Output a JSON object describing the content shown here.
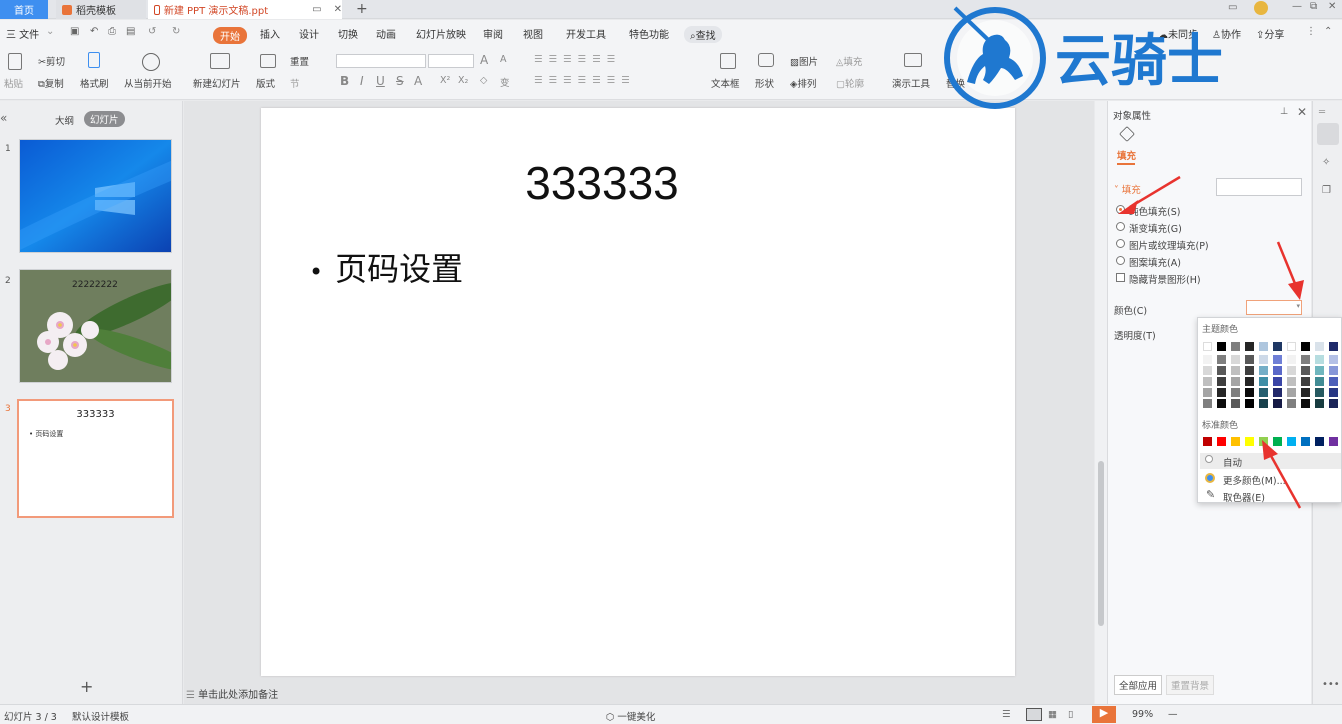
{
  "titlebar": {
    "home_tab": "首页",
    "template_tab": "稻壳模板",
    "doc_tab": "新建 PPT 演示文稿.ppt",
    "new_tab": "+"
  },
  "menubar": {
    "file": "三 文件",
    "start": "开始",
    "items": [
      "插入",
      "设计",
      "切换",
      "动画",
      "幻灯片放映",
      "审阅",
      "视图",
      "开发工具",
      "特色功能"
    ],
    "search": "查找",
    "sync": "未同步",
    "collab": "协作",
    "share": "分享"
  },
  "ribbon": {
    "paste": "粘贴",
    "cut": "剪切",
    "copy": "复制",
    "format_painter": "格式刷",
    "from_current": "从当前开始",
    "new_slide": "新建幻灯片",
    "layout": "版式",
    "reset": "重置",
    "section": "节",
    "textbox": "文本框",
    "shape": "形状",
    "picture": "图片",
    "arrange": "排列",
    "fill": "填充",
    "outline": "轮廓",
    "presentation_tools": "演示工具",
    "replace": "替换"
  },
  "leftpane": {
    "outline_tab": "大纲",
    "slides_tab": "幻灯片",
    "slide_numbers": [
      "1",
      "2",
      "3"
    ],
    "slide2_title": "22222222",
    "slide3_title": "333333",
    "slide3_bullet": "• 页码设置",
    "add": "+"
  },
  "slide": {
    "title": "333333",
    "bullet": "页码设置"
  },
  "notes": "单击此处添加备注",
  "rightpanel": {
    "header": "对象属性",
    "fill_tab": "填充",
    "fill_section": "填充",
    "options": [
      "纯色填充(S)",
      "渐变填充(G)",
      "图片或纹理填充(P)",
      "图案填充(A)"
    ],
    "hide_bg": "隐藏背景图形(H)",
    "color_label": "颜色(C)",
    "transparency_label": "透明度(T)",
    "apply_all": "全部应用",
    "reset_bg": "重置背景"
  },
  "palette": {
    "theme_colors": "主题颜色",
    "standard_colors": "标准颜色",
    "auto": "自动",
    "more_colors": "更多颜色(M)...",
    "eyedropper": "取色器(E)",
    "standard": [
      "#c00000",
      "#ff0000",
      "#ffc000",
      "#ffff00",
      "#92d050",
      "#00b050",
      "#00b0f0",
      "#0070c0",
      "#002060",
      "#7030a0"
    ]
  },
  "logo": {
    "text": "云骑士"
  },
  "statusbar": {
    "slide_info": "幻灯片 3 / 3",
    "template": "默认设计模板",
    "beautify": "一键美化",
    "zoom": "99%"
  }
}
